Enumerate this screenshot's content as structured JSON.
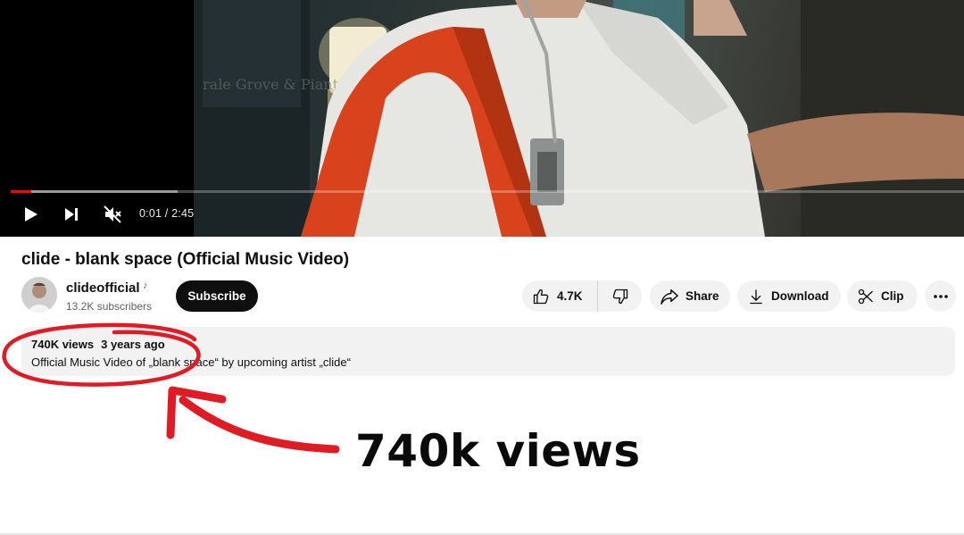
{
  "player": {
    "time_display": "0:01 / 2:45",
    "progress_fraction": 0.0062,
    "buffered_fraction": 0.175,
    "controls": [
      "play-icon",
      "next-icon",
      "muted-volume-icon"
    ]
  },
  "video": {
    "title": "clide - blank space (Official Music Video)"
  },
  "channel": {
    "name": "clideofficial",
    "badge_icon": "music-note-icon",
    "subscribers": "13.2K subscribers",
    "subscribe_label": "Subscribe"
  },
  "actions": {
    "like_count": "4.7K",
    "share_label": "Share",
    "download_label": "Download",
    "clip_label": "Clip",
    "more_icon": "more-horizontal-icon"
  },
  "description": {
    "views": "740K views",
    "age": "3 years ago",
    "text": "Official Music Video of „blank space“ by upcoming artist „clide“"
  },
  "annotation": {
    "caption": "740k views",
    "color": "#e01b24"
  }
}
